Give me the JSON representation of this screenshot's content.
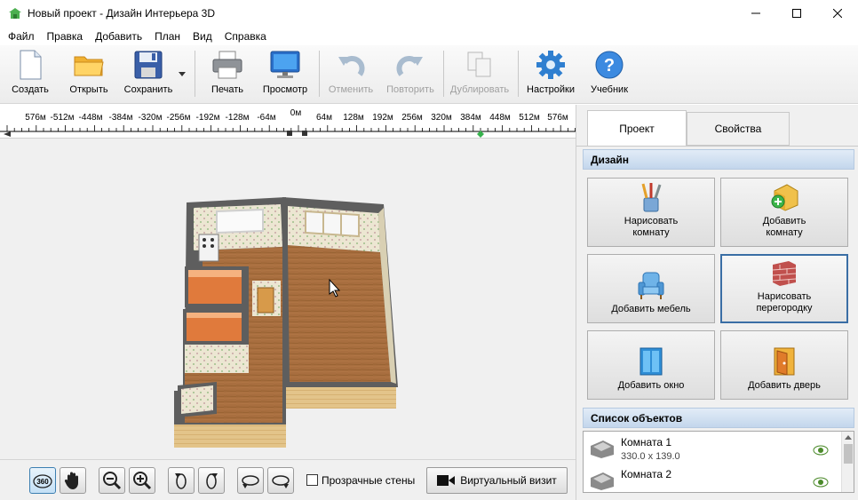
{
  "window": {
    "title": "Новый проект - Дизайн Интерьера 3D"
  },
  "menu": [
    "Файл",
    "Правка",
    "Добавить",
    "План",
    "Вид",
    "Справка"
  ],
  "toolbar": {
    "create": "Создать",
    "open": "Открыть",
    "save": "Сохранить",
    "print": "Печать",
    "preview": "Просмотр",
    "undo": "Отменить",
    "redo": "Повторить",
    "duplicate": "Дублировать",
    "settings": "Настройки",
    "tutorial": "Учебник"
  },
  "ruler": {
    "labels": [
      "576м",
      "-512м",
      "-448м",
      "-384м",
      "-320м",
      "-256м",
      "-192м",
      "-128м",
      "-64м",
      "0м",
      "64м",
      "128м",
      "192м",
      "256м",
      "320м",
      "384м",
      "448м",
      "512м",
      "576м"
    ]
  },
  "bottom": {
    "transparent_walls": "Прозрачные стены",
    "virtual_visit": "Виртуальный визит",
    "rotate_360_label": "360"
  },
  "panel": {
    "tabs": [
      "Проект",
      "Свойства"
    ],
    "design_header": "Дизайн",
    "buttons": {
      "draw_room": "Нарисовать комнату",
      "add_room": "Добавить комнату",
      "add_furniture": "Добавить мебель",
      "draw_partition": "Нарисовать перегородку",
      "add_window": "Добавить окно",
      "add_door": "Добавить дверь"
    },
    "objects_header": "Список объектов",
    "objects": [
      {
        "name": "Комната 1",
        "size": "330.0 x 139.0"
      },
      {
        "name": "Комната 2",
        "size": ""
      }
    ]
  },
  "colors": {
    "accent": "#3a6ea5",
    "floor": "#a86e3f",
    "wall": "#5e5e5e",
    "wallpaper": "#ece6d2"
  }
}
